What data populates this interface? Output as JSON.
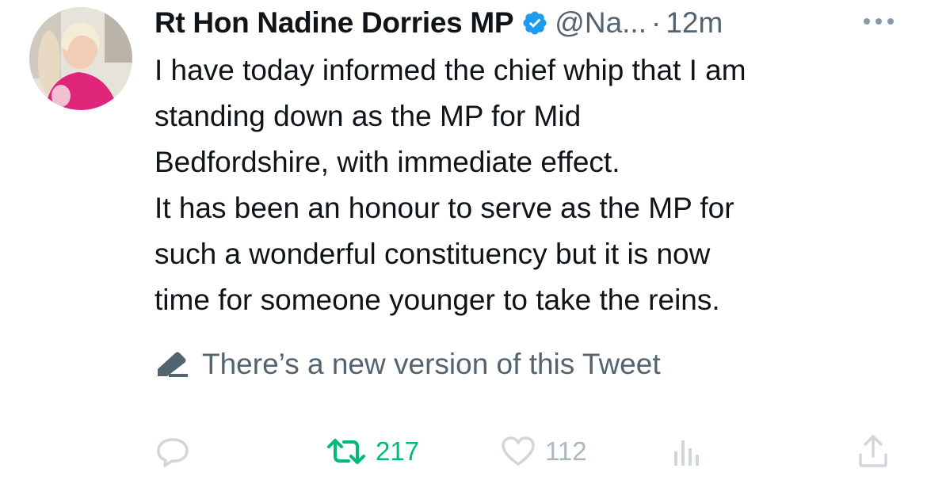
{
  "tweet": {
    "display_name": "Rt Hon Nadine Dorries MP",
    "handle": "@Na...",
    "separator": "·",
    "time": "12m",
    "body_lines": [
      "I have today informed the chief whip that I am",
      "standing down as the MP for Mid",
      "Bedfordshire, with immediate effect.",
      "It has been an honour to serve as the MP for",
      "such a wonderful constituency but it is now",
      "time for someone younger to take the reins."
    ],
    "edit_notice": "There’s a new version of this Tweet"
  },
  "actions": {
    "reply": {
      "icon": "reply-icon"
    },
    "retweet": {
      "icon": "retweet-icon",
      "count": "217"
    },
    "like": {
      "icon": "heart-icon",
      "count": "112"
    },
    "views": {
      "icon": "views-icon"
    },
    "share": {
      "icon": "share-icon"
    }
  },
  "colors": {
    "text": "#0f1419",
    "secondary": "#536471",
    "verified_blue": "#1d9bf0",
    "retweet_green": "#00ba7c",
    "faded_icon": "#d0d6db"
  }
}
